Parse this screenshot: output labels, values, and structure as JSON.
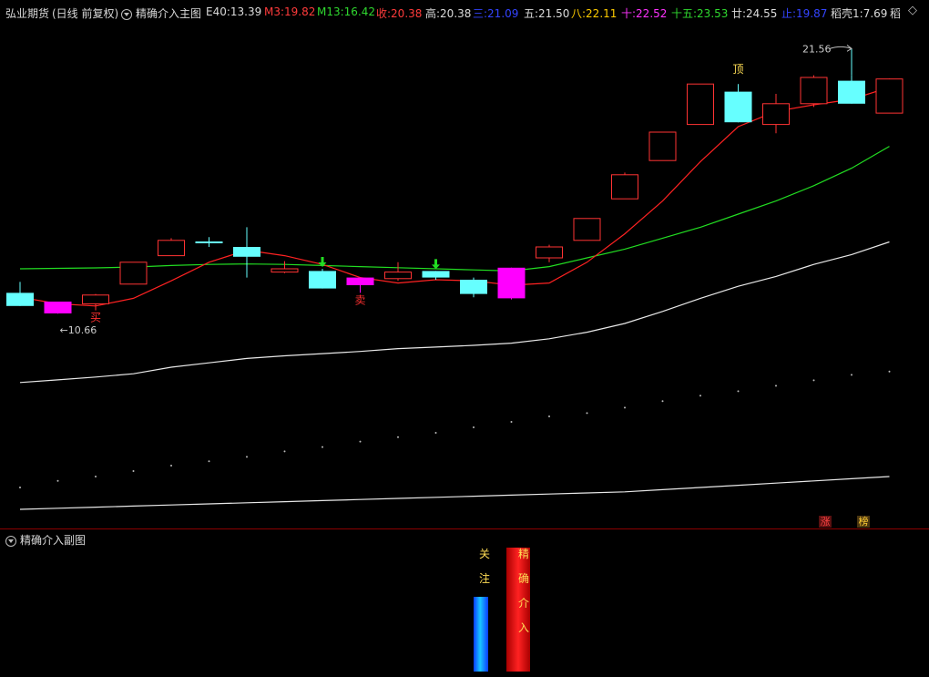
{
  "header": {
    "source": "弘业期货",
    "mode": "(日线 前复权)",
    "indicator": "精确介入主图",
    "stats": [
      {
        "label": "E40:",
        "value": "13.39",
        "color": "#dcdcdc"
      },
      {
        "label": "M3:",
        "value": "19.82",
        "color": "#ff3b3b"
      },
      {
        "label": "M13:",
        "value": "16.42",
        "color": "#2fd82f"
      },
      {
        "label": "收:",
        "value": "20.38",
        "color": "#ff3b3b"
      },
      {
        "label": "高:",
        "value": "20.38",
        "color": "#dcdcdc"
      },
      {
        "label": "三:",
        "value": "21.09",
        "color": "#3344ff"
      },
      {
        "label": "五:",
        "value": "21.50",
        "color": "#dcdcdc"
      },
      {
        "label": "八:",
        "value": "22.11",
        "color": "#ffcc00"
      },
      {
        "label": "十:",
        "value": "22.52",
        "color": "#ff33ff"
      },
      {
        "label": "十五:",
        "value": "23.53",
        "color": "#2fd82f"
      },
      {
        "label": "廿:",
        "value": "24.55",
        "color": "#dcdcdc"
      },
      {
        "label": "止:",
        "value": "19.87",
        "color": "#3344ff"
      },
      {
        "label": "稻壳1:",
        "value": "7.69",
        "color": "#dcdcdc"
      },
      {
        "label": "稻",
        "value": "",
        "color": "#dcdcdc"
      }
    ],
    "menu_icon": "diamond-menu-icon"
  },
  "chart_data": {
    "type": "candlestick",
    "candles": [
      {
        "o": 11.6,
        "h": 12.1,
        "l": 11.0,
        "c": 11.0,
        "color": "cyan"
      },
      {
        "o": 11.2,
        "h": 11.2,
        "l": 10.65,
        "c": 10.66,
        "color": "magenta"
      },
      {
        "o": 11.1,
        "h": 11.55,
        "l": 10.8,
        "c": 11.5,
        "color": "red"
      },
      {
        "o": 12.0,
        "h": 13.0,
        "l": 12.0,
        "c": 13.0,
        "color": "red"
      },
      {
        "o": 13.3,
        "h": 14.1,
        "l": 13.3,
        "c": 14.0,
        "color": "red"
      },
      {
        "o": 13.95,
        "h": 14.15,
        "l": 13.7,
        "c": 13.95,
        "color": "cyan"
      },
      {
        "o": 13.7,
        "h": 14.6,
        "l": 12.3,
        "c": 13.25,
        "color": "cyan"
      },
      {
        "o": 12.55,
        "h": 13.05,
        "l": 12.5,
        "c": 12.7,
        "color": "red"
      },
      {
        "o": 12.6,
        "h": 12.7,
        "l": 11.8,
        "c": 11.8,
        "color": "cyan"
      },
      {
        "o": 12.3,
        "h": 12.3,
        "l": 11.6,
        "c": 11.95,
        "color": "magenta"
      },
      {
        "o": 12.25,
        "h": 13.0,
        "l": 12.15,
        "c": 12.55,
        "color": "red"
      },
      {
        "o": 12.6,
        "h": 12.6,
        "l": 12.2,
        "c": 12.3,
        "color": "cyan"
      },
      {
        "o": 12.2,
        "h": 12.3,
        "l": 11.4,
        "c": 11.55,
        "color": "cyan"
      },
      {
        "o": 12.75,
        "h": 12.75,
        "l": 11.3,
        "c": 11.35,
        "color": "magenta"
      },
      {
        "o": 13.2,
        "h": 13.8,
        "l": 13.0,
        "c": 13.7,
        "color": "red"
      },
      {
        "o": 14.0,
        "h": 15.0,
        "l": 14.0,
        "c": 15.0,
        "color": "red"
      },
      {
        "o": 15.9,
        "h": 17.1,
        "l": 15.9,
        "c": 17.0,
        "color": "red"
      },
      {
        "o": 17.65,
        "h": 18.95,
        "l": 17.65,
        "c": 18.95,
        "color": "red"
      },
      {
        "o": 19.3,
        "h": 21.15,
        "l": 19.3,
        "c": 21.15,
        "color": "red"
      },
      {
        "o": 20.8,
        "h": 21.15,
        "l": 19.4,
        "c": 19.4,
        "color": "cyan"
      },
      {
        "o": 19.3,
        "h": 20.7,
        "l": 18.9,
        "c": 20.25,
        "color": "red"
      },
      {
        "o": 20.25,
        "h": 21.55,
        "l": 20.1,
        "c": 21.45,
        "color": "red"
      },
      {
        "o": 21.3,
        "h": 21.56,
        "l": 20.25,
        "c": 20.25,
        "color": "cyan"
      },
      {
        "o": 19.82,
        "h": 21.4,
        "l": 19.82,
        "c": 21.38,
        "color": "red"
      }
    ],
    "ma_red": [
      11.4,
      11.1,
      11.0,
      11.35,
      12.15,
      13.0,
      13.55,
      13.3,
      12.9,
      12.3,
      12.05,
      12.2,
      12.15,
      11.95,
      12.05,
      13.0,
      14.3,
      15.8,
      17.6,
      19.2,
      19.9,
      20.2,
      20.45,
      21.0
    ],
    "ma_green": [
      12.7,
      12.72,
      12.74,
      12.78,
      12.85,
      12.9,
      12.92,
      12.9,
      12.85,
      12.8,
      12.75,
      12.7,
      12.65,
      12.6,
      12.8,
      13.2,
      13.6,
      14.1,
      14.6,
      15.2,
      15.8,
      16.5,
      17.3,
      18.3
    ],
    "ma_white": [
      7.5,
      7.62,
      7.75,
      7.9,
      8.2,
      8.4,
      8.6,
      8.72,
      8.82,
      8.92,
      9.05,
      9.12,
      9.2,
      9.3,
      9.5,
      9.8,
      10.2,
      10.75,
      11.35,
      11.9,
      12.35,
      12.9,
      13.35,
      13.93
    ],
    "ma_white2": [
      1.7,
      1.75,
      1.8,
      1.85,
      1.9,
      1.95,
      2.0,
      2.05,
      2.1,
      2.15,
      2.2,
      2.25,
      2.3,
      2.35,
      2.4,
      2.45,
      2.5,
      2.6,
      2.7,
      2.8,
      2.9,
      3.0,
      3.1,
      3.2
    ],
    "dots_y": [
      2.7,
      3.0,
      3.2,
      3.45,
      3.7,
      3.9,
      4.1,
      4.35,
      4.55,
      4.8,
      5.0,
      5.2,
      5.45,
      5.7,
      5.95,
      6.1,
      6.35,
      6.65,
      6.9,
      7.1,
      7.35,
      7.6,
      7.85,
      8.0
    ],
    "labels": [
      {
        "text": "买",
        "index": 2,
        "color": "#ff3030"
      },
      {
        "text": "卖",
        "index": 9,
        "color": "#ff3030"
      },
      {
        "text": "顶",
        "index": 19,
        "color": "#ffdd55"
      }
    ],
    "down_arrows": [
      8,
      11
    ],
    "low_marker": "←10.66",
    "high_marker": "21.56"
  },
  "sub_chart": {
    "title": "精确介入副图",
    "focus_chars": [
      "关",
      "注"
    ],
    "entry_chars": [
      "精",
      "确",
      "介",
      "入"
    ]
  },
  "badges": [
    {
      "text": "涨",
      "color": "#ff4444"
    },
    {
      "text": "榜",
      "color": "#ffcc33"
    }
  ]
}
